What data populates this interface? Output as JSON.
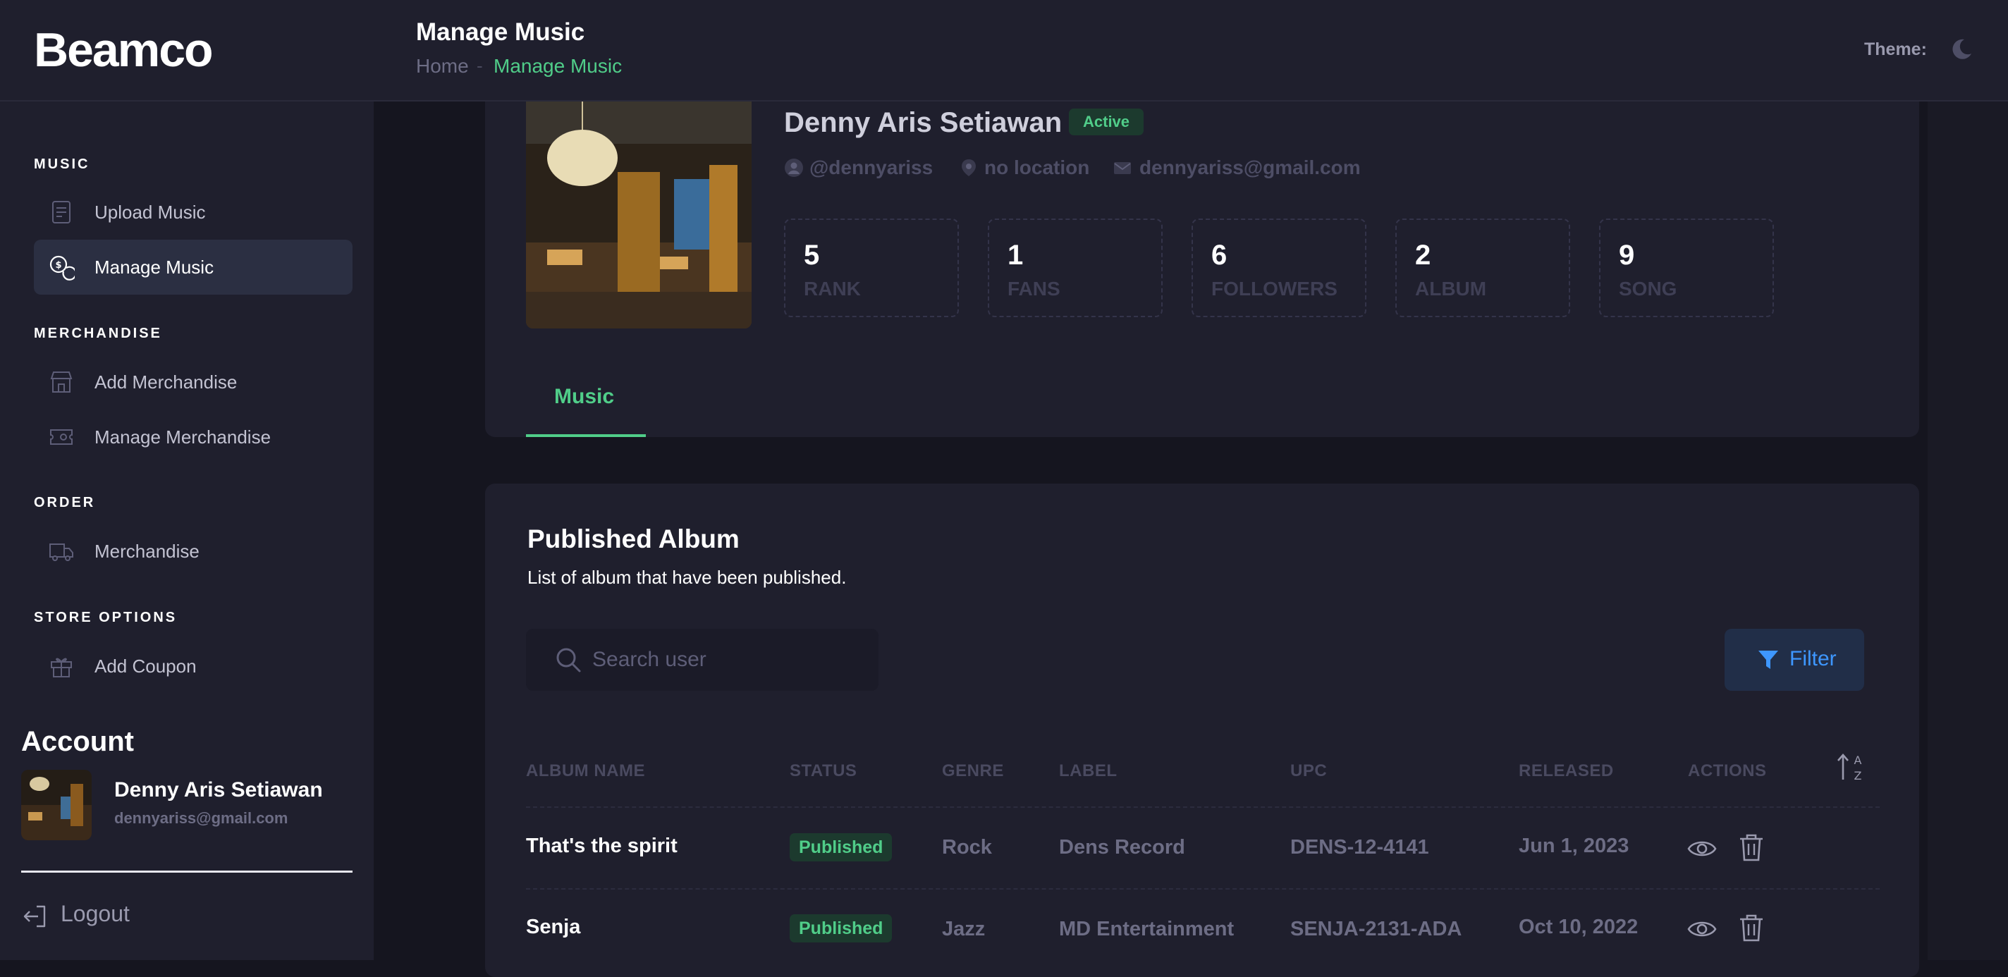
{
  "app": {
    "logo": "Beamco"
  },
  "header": {
    "title": "Manage Music",
    "breadcrumb": {
      "home": "Home",
      "separator": "-",
      "current": "Manage Music"
    },
    "theme_label": "Theme:",
    "theme_icon": "moon-icon"
  },
  "sidebar": {
    "sections": [
      {
        "title": "MUSIC",
        "items": [
          {
            "label": "Upload Music",
            "icon": "receipt-icon",
            "active": false
          },
          {
            "label": "Manage Music",
            "icon": "coins-icon",
            "active": true
          }
        ]
      },
      {
        "title": "MERCHANDISE",
        "items": [
          {
            "label": "Add Merchandise",
            "icon": "shop-icon",
            "active": false
          },
          {
            "label": "Manage Merchandise",
            "icon": "ticket-icon",
            "active": false
          }
        ]
      },
      {
        "title": "ORDER",
        "items": [
          {
            "label": "Merchandise",
            "icon": "truck-icon",
            "active": false
          }
        ]
      },
      {
        "title": "STORE OPTIONS",
        "items": [
          {
            "label": "Add Coupon",
            "icon": "gift-icon",
            "active": false
          }
        ]
      }
    ],
    "account": {
      "title": "Account",
      "name": "Denny Aris Setiawan",
      "email": "dennyariss@gmail.com",
      "logout_label": "Logout"
    }
  },
  "profile": {
    "name": "Denny Aris Setiawan",
    "status": "Active",
    "username": "@dennyariss",
    "location": "no location",
    "email": "dennyariss@gmail.com",
    "stats": [
      {
        "value": "5",
        "label": "RANK"
      },
      {
        "value": "1",
        "label": "FANS"
      },
      {
        "value": "6",
        "label": "FOLLOWERS"
      },
      {
        "value": "2",
        "label": "ALBUM"
      },
      {
        "value": "9",
        "label": "SONG"
      }
    ],
    "tab": "Music"
  },
  "albums": {
    "title": "Published Album",
    "subtitle": "List of album that have been published.",
    "search_placeholder": "Search user",
    "filter_label": "Filter",
    "columns": [
      "ALBUM NAME",
      "STATUS",
      "GENRE",
      "LABEL",
      "UPC",
      "RELEASED",
      "ACTIONS"
    ],
    "rows": [
      {
        "name": "That's the spirit",
        "status": "Published",
        "genre": "Rock",
        "label": "Dens Record",
        "upc": "DENS-12-4141",
        "released": "Jun 1, 2023"
      },
      {
        "name": "Senja",
        "status": "Published",
        "genre": "Jazz",
        "label": "MD Entertainment",
        "upc": "SENJA-2131-ADA",
        "released": "Oct 10, 2022"
      }
    ]
  },
  "colors": {
    "accent": "#50cd89",
    "primary": "#3e97ff",
    "background": "#15151f",
    "card": "#1f1f2d"
  }
}
